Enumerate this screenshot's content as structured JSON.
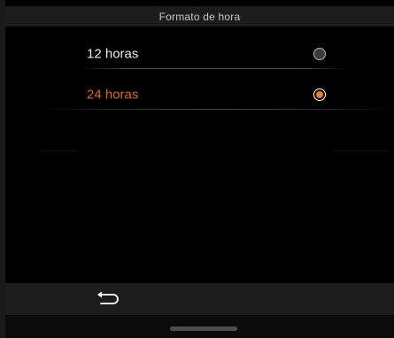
{
  "header": {
    "title": "Formato de hora"
  },
  "options": [
    {
      "label": "12 horas",
      "selected": false
    },
    {
      "label": "24 horas",
      "selected": true
    }
  ],
  "colors": {
    "accent": "#f07a1e",
    "selected_text": "#e0642a",
    "text": "#ececec",
    "background": "#000000",
    "bar": "#1c1c1c"
  },
  "footer": {
    "back_icon": "back-arrow-icon"
  }
}
